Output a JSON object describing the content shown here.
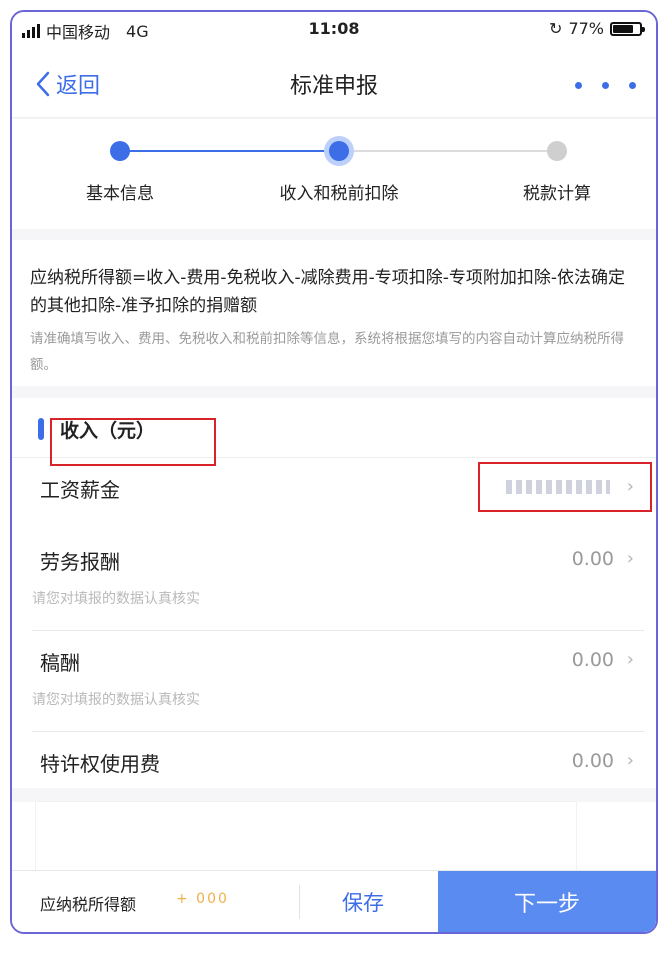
{
  "status_bar": {
    "carrier": "中国移动",
    "network": "4G",
    "time": "11:08",
    "battery": "77%",
    "battery_level": 0.77
  },
  "nav": {
    "back_label": "返回",
    "title": "标准申报"
  },
  "stepper": {
    "steps": [
      {
        "label": "基本信息",
        "state": "done"
      },
      {
        "label": "收入和税前扣除",
        "state": "current"
      },
      {
        "label": "税款计算",
        "state": "pending"
      }
    ]
  },
  "formula": {
    "text": "应纳税所得额=收入-费用-免税收入-减除费用-专项扣除-专项附加扣除-依法确定的其他扣除-准予扣除的捐赠额",
    "note": "请准确填写收入、费用、免税收入和税前扣除等信息，系统将根据您填写的内容自动计算应纳税所得额。"
  },
  "income": {
    "title": "收入（元）",
    "items": [
      {
        "label": "工资薪金",
        "value": "",
        "hint": ""
      },
      {
        "label": "劳务报酬",
        "value": "0.00",
        "hint": "请您对填报的数据认真核实"
      },
      {
        "label": "稿酬",
        "value": "0.00",
        "hint": "请您对填报的数据认真核实"
      },
      {
        "label": "特许权使用费",
        "value": "0.00",
        "hint": ""
      }
    ]
  },
  "bottom": {
    "taxable_label": "应纳税所得额",
    "taxable_value": "+ 000",
    "save_label": "保存",
    "next_label": "下一步"
  },
  "colors": {
    "accent": "#3d6ee8",
    "next_button": "#5a8bf0",
    "highlight_box": "#d8232a"
  }
}
